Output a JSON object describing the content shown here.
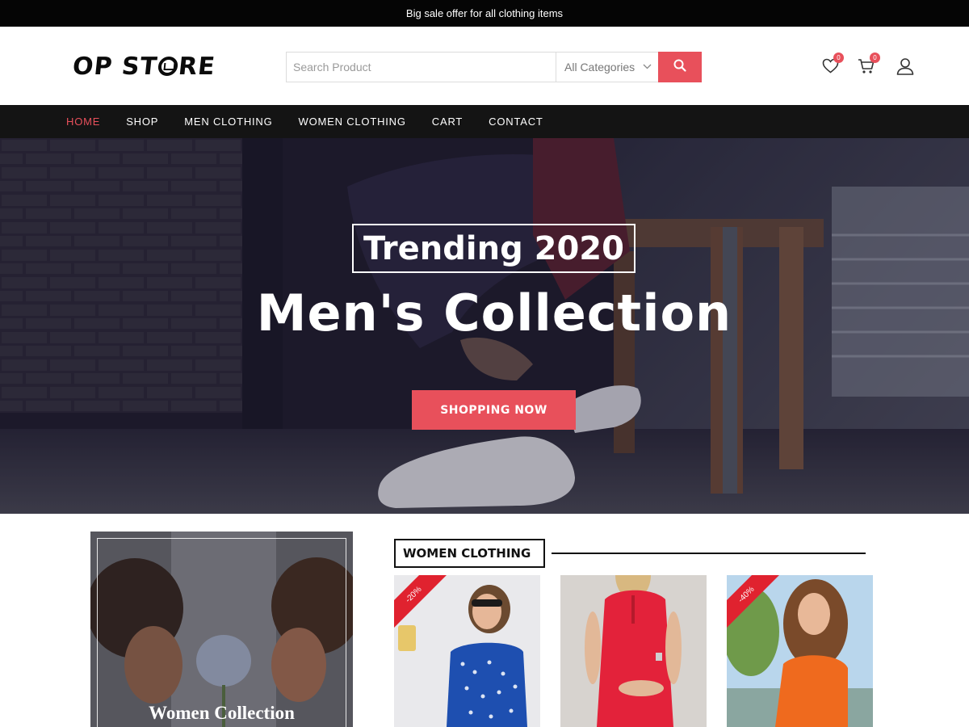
{
  "topbar": {
    "text": "Big sale offer for all clothing items"
  },
  "header": {
    "logo_text": "OP STORE",
    "search": {
      "placeholder": "Search Product",
      "category": "All Categories"
    },
    "wishlist_count": "0",
    "cart_count": "0"
  },
  "nav": {
    "items": [
      {
        "label": "HOME",
        "active": true
      },
      {
        "label": "SHOP"
      },
      {
        "label": "MEN CLOTHING"
      },
      {
        "label": "WOMEN CLOTHING"
      },
      {
        "label": "CART"
      },
      {
        "label": "CONTACT"
      }
    ]
  },
  "hero": {
    "tag": "Trending 2020",
    "headline": "Men's Collection",
    "cta": "SHOPPING NOW"
  },
  "collection": {
    "title": "Women Collection"
  },
  "section": {
    "title": "WOMEN CLOTHING"
  },
  "products": [
    {
      "discount": "-20%"
    },
    {
      "discount": ""
    },
    {
      "discount": "-40%"
    }
  ],
  "colors": {
    "accent": "#e8505b",
    "nav_bg": "#141414",
    "topbar_bg": "#050505",
    "discount_red": "#e0222f"
  },
  "icons": [
    "search-icon",
    "heart-icon",
    "cart-icon",
    "user-icon",
    "chevron-down-icon"
  ]
}
